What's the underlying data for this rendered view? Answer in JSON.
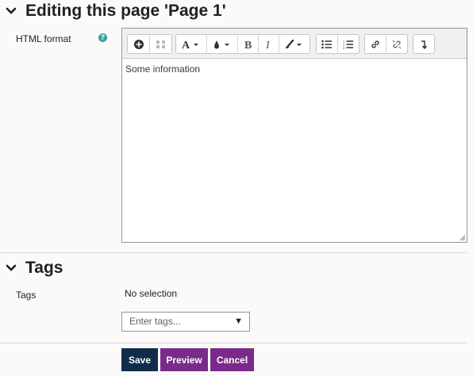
{
  "header": {
    "title": "Editing this page 'Page 1'"
  },
  "editor_field": {
    "label": "HTML format",
    "help_icon": "question-circle-icon",
    "content": "Some information",
    "toolbar": [
      {
        "group": "toggle",
        "icons": [
          "expand-toolbar-icon",
          "accessibility-icon"
        ]
      },
      {
        "group": "font",
        "icons": [
          "font-size-icon"
        ]
      },
      {
        "group": "color",
        "icons": [
          "text-color-icon"
        ]
      },
      {
        "group": "style",
        "icons": [
          "bold-icon",
          "italic-icon",
          "paint-brush-icon"
        ]
      },
      {
        "group": "lists",
        "icons": [
          "bullet-list-icon",
          "numbered-list-icon"
        ]
      },
      {
        "group": "links",
        "icons": [
          "link-icon",
          "unlink-icon"
        ]
      },
      {
        "group": "insert",
        "icons": [
          "return-icon"
        ]
      }
    ]
  },
  "tags_section": {
    "title": "Tags",
    "label": "Tags",
    "selection_text": "No selection",
    "input_placeholder": "Enter tags..."
  },
  "buttons": {
    "save": "Save",
    "preview": "Preview",
    "cancel": "Cancel"
  },
  "colors": {
    "save_bg": "#0f2d4a",
    "secondary_bg": "#7a2a8a",
    "help_teal": "#3a9f9c"
  }
}
